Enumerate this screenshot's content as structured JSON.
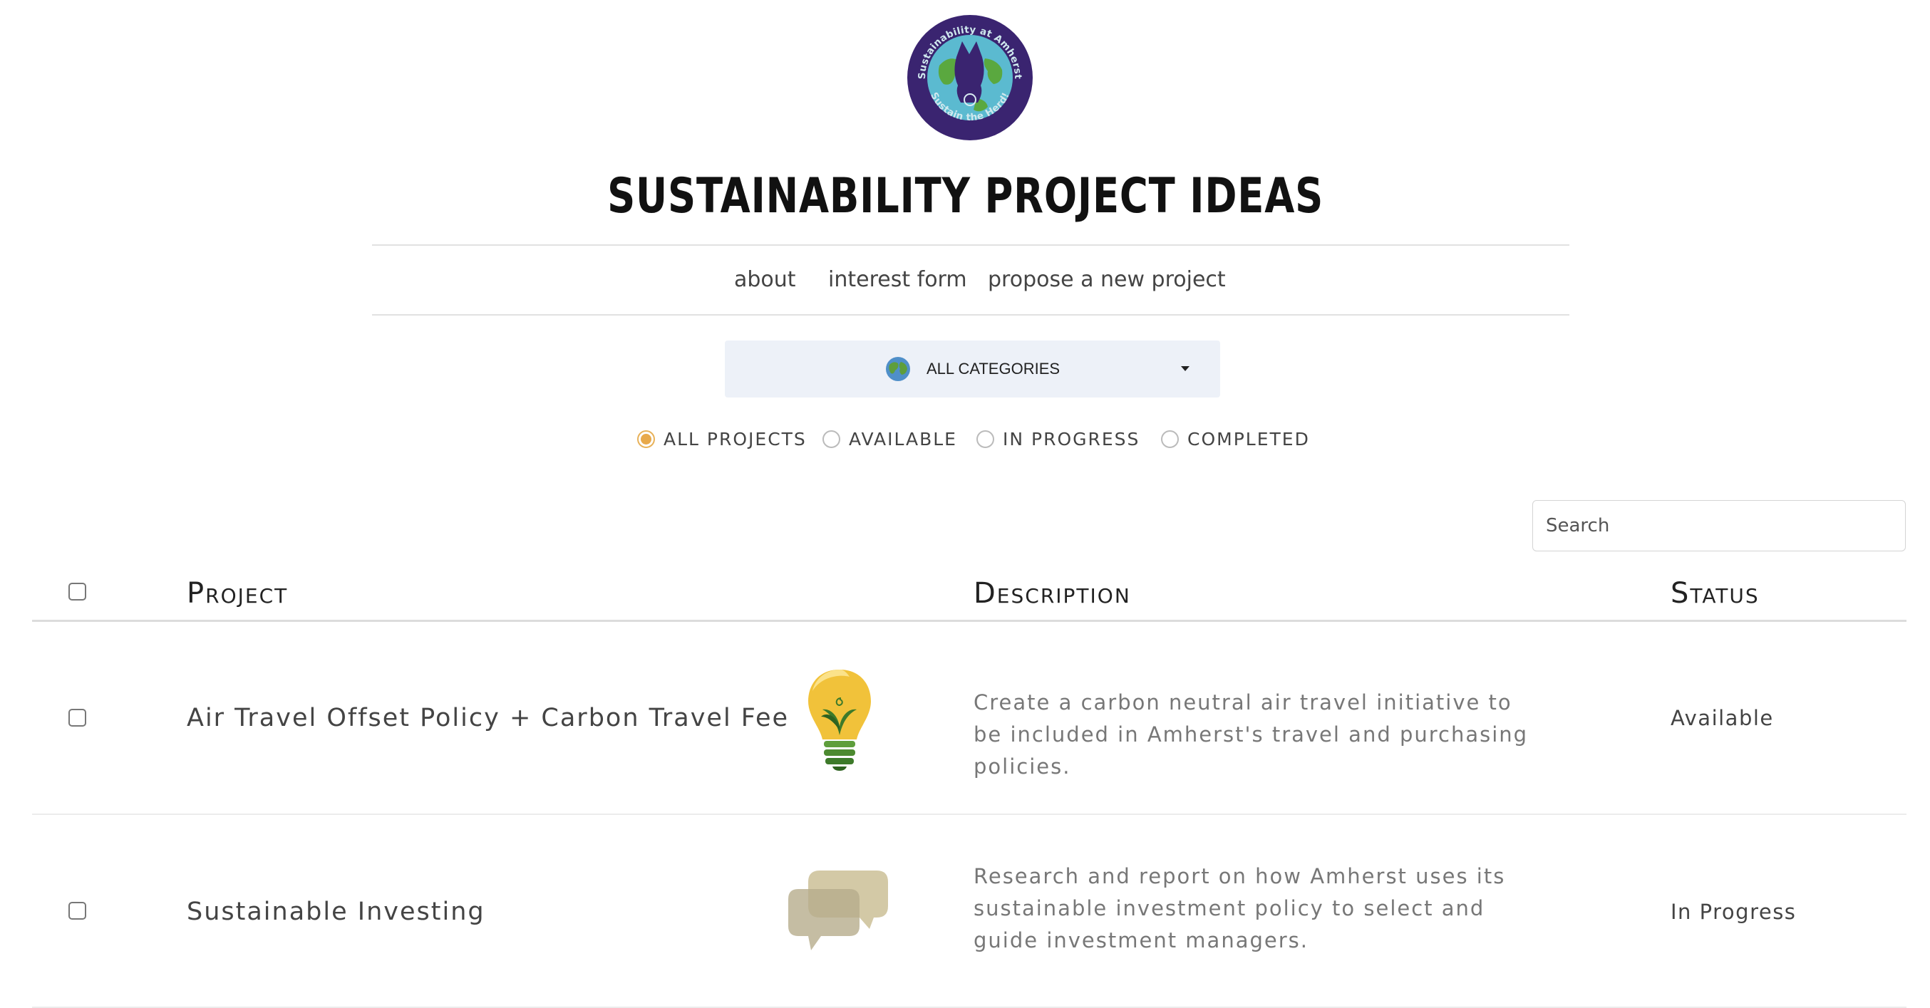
{
  "logo": {
    "ring_top_text": "Sustainability at Amherst",
    "ring_bottom_text": "Sustain the Herd!"
  },
  "page_title": "SUSTAINABILITY PROJECT IDEAS",
  "nav": {
    "about": "about",
    "interest_form": "interest form",
    "propose": "propose a new project"
  },
  "category_filter": {
    "icon": "globe-icon",
    "selected": "ALL CATEGORIES"
  },
  "status_filter": {
    "selected": "ALL PROJECTS",
    "options": [
      "ALL PROJECTS",
      "AVAILABLE",
      "IN PROGRESS",
      "COMPLETED"
    ]
  },
  "search": {
    "placeholder": "Search"
  },
  "table": {
    "headers": {
      "project": "Project",
      "description": "Description",
      "status": "Status"
    },
    "rows": [
      {
        "project": "Air Travel Offset Policy + Carbon Travel Fee",
        "icon": "lightbulb-leaf-icon",
        "description": "Create a carbon neutral air travel initiative to be included in Amherst's travel and purchasing policies.",
        "status": "Available"
      },
      {
        "project": "Sustainable Investing",
        "icon": "speech-bubbles-icon",
        "description": "Research and report on how Amherst uses its sustainable investment policy to select and guide investment managers.",
        "status": "In Progress"
      }
    ]
  },
  "colors": {
    "logo_purple": "#3a2470",
    "logo_sea": "#5bbad0",
    "radio_accent": "#e8a94a",
    "dropdown_bg": "#edf1f8"
  }
}
